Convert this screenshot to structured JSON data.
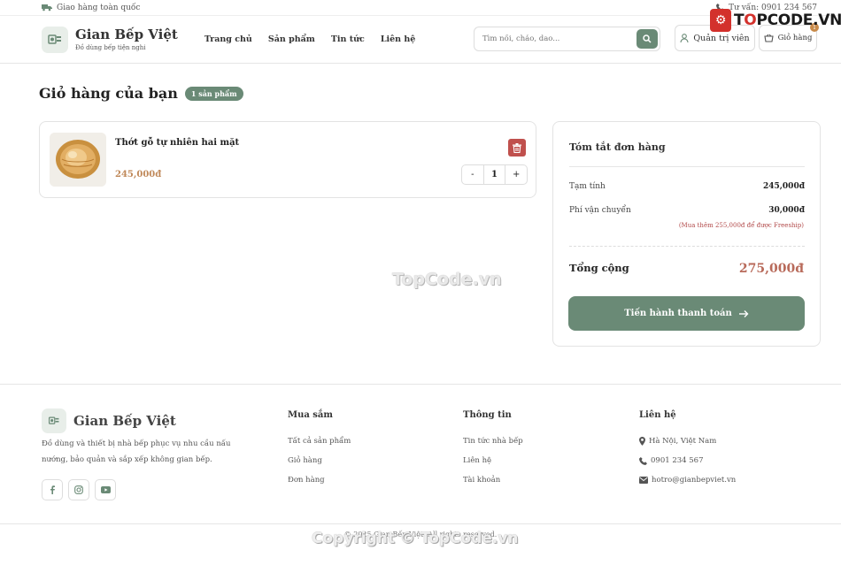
{
  "topbar": {
    "shipping_text": "Giao hàng toàn quốc",
    "hotline_text": "Tư vấn: 0901 234 567"
  },
  "header": {
    "brand_title": "Gian Bếp Việt",
    "brand_subtitle": "Đồ dùng bếp tiện nghi",
    "nav": [
      "Trang chủ",
      "Sản phẩm",
      "Tin tức",
      "Liên hệ"
    ],
    "search_placeholder": "Tìm nồi, chảo, dao...",
    "admin_label": "Quản trị viên",
    "cart_label": "Giỏ hàng",
    "cart_count": "1"
  },
  "watermark": {
    "logo_prefix": "T",
    "logo_o": "O",
    "logo_suffix": "PCODE.VN",
    "center": "TopCode.vn",
    "bottom": "Copyright © TopCode.vn"
  },
  "cart": {
    "title": "Giỏ hàng của bạn",
    "count_badge": "1 sản phẩm",
    "items": [
      {
        "name": "Thớt gỗ tự nhiên hai mặt",
        "price": "245,000đ",
        "quantity": "1"
      }
    ],
    "qty_minus": "-",
    "qty_plus": "+"
  },
  "summary": {
    "title": "Tóm tắt đơn hàng",
    "subtotal_label": "Tạm tính",
    "subtotal_value": "245,000đ",
    "shipping_label": "Phí vận chuyển",
    "shipping_value": "30,000đ",
    "shipping_note": "(Mua thêm 255,000đ để được Freeship)",
    "total_label": "Tổng cộng",
    "total_value": "275,000đ",
    "checkout_label": "Tiến hành thanh toán"
  },
  "footer": {
    "brand": "Gian Bếp Việt",
    "description": "Đồ dùng và thiết bị nhà bếp phục vụ nhu cầu nấu nướng, bảo quản và sắp xếp không gian bếp.",
    "columns": [
      {
        "title": "Mua sắm",
        "links": [
          "Tất cả sản phẩm",
          "Giỏ hàng",
          "Đơn hàng"
        ]
      },
      {
        "title": "Thông tin",
        "links": [
          "Tin tức nhà bếp",
          "Liên hệ",
          "Tài khoản"
        ]
      },
      {
        "title": "Liên hệ",
        "links": [
          "Hà Nội, Việt Nam",
          "0901 234 567",
          "hotro@gianbepviet.vn"
        ]
      }
    ],
    "copyright": "© 2025 Gian Bếp Việt. All rights reserved."
  },
  "colors": {
    "accent": "#6a8a76",
    "price": "#c0895a",
    "danger": "#c0504d",
    "total": "#b86a5a"
  }
}
